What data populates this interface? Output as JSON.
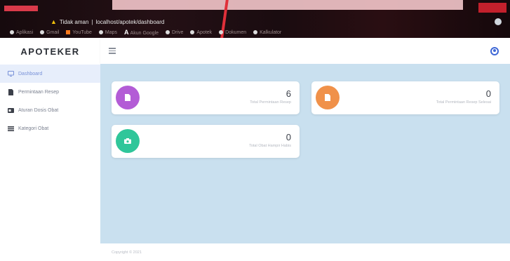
{
  "browser": {
    "address_warning": "Tidak aman",
    "address_url": "localhost/apotek/dashboard",
    "bookmarks": [
      "Aplikasi",
      "Gmail",
      "YouTube",
      "Maps",
      "Akun Google",
      "Drive",
      "Apotek",
      "Dokumen",
      "Kalkulator"
    ]
  },
  "sidebar": {
    "brand": "APOTEKER",
    "items": [
      {
        "label": "Dashboard",
        "icon": "monitor-icon",
        "active": true
      },
      {
        "label": "Permintaan Resep",
        "icon": "document-icon",
        "active": false
      },
      {
        "label": "Aturan Dosis Obat",
        "icon": "card-icon",
        "active": false
      },
      {
        "label": "Kategori Obat",
        "icon": "list-icon",
        "active": false
      }
    ]
  },
  "header": {
    "menu_icon": "hamburger-icon",
    "user_icon": "user-circle-icon"
  },
  "cards": [
    {
      "count": "6",
      "label": "Total Permintaan Resep",
      "color": "#b35cd6",
      "icon": "file-icon"
    },
    {
      "count": "0",
      "label": "Total Permintaan Resep Selesai",
      "color": "#f0914a",
      "icon": "file-icon"
    },
    {
      "count": "0",
      "label": "Total Obat Hampir Habis",
      "color": "#2fc69a",
      "icon": "camera-icon"
    }
  ],
  "footer": {
    "text": "Copyright © 2021"
  },
  "colors": {
    "main_bg": "#c9e0ef",
    "active_nav": "#e7eefb",
    "accent": "#3f68d6"
  }
}
